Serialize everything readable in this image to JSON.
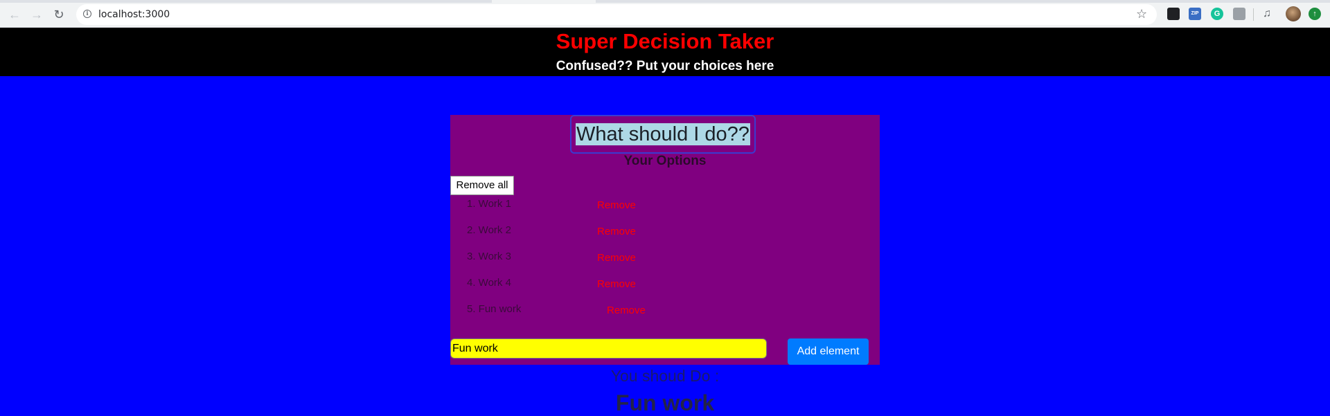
{
  "browser": {
    "url": "localhost:3000"
  },
  "header": {
    "title": "Super Decision Taker",
    "subtitle": "Confused?? Put your choices here"
  },
  "card": {
    "decide_label": "What should I do??",
    "options_heading": "Your Options",
    "remove_all_label": "Remove all",
    "options": [
      {
        "label": "1. Work 1",
        "remove_label": "Remove"
      },
      {
        "label": "2. Work 2",
        "remove_label": "Remove"
      },
      {
        "label": "3. Work 3",
        "remove_label": "Remove"
      },
      {
        "label": "4. Work 4",
        "remove_label": "Remove"
      },
      {
        "label": "5. Fun work",
        "remove_label": "Remove"
      }
    ],
    "input_value": "Fun work",
    "add_label": "Add element"
  },
  "result": {
    "label": "You shoud Do :",
    "value": "Fun work"
  },
  "colors": {
    "page_bg": "#0000ff",
    "header_bg": "#000000",
    "title": "#ff0000",
    "card_bg": "#800080",
    "remove": "#ff0000",
    "input_bg": "#ffff00",
    "add_button": "#007bff"
  }
}
